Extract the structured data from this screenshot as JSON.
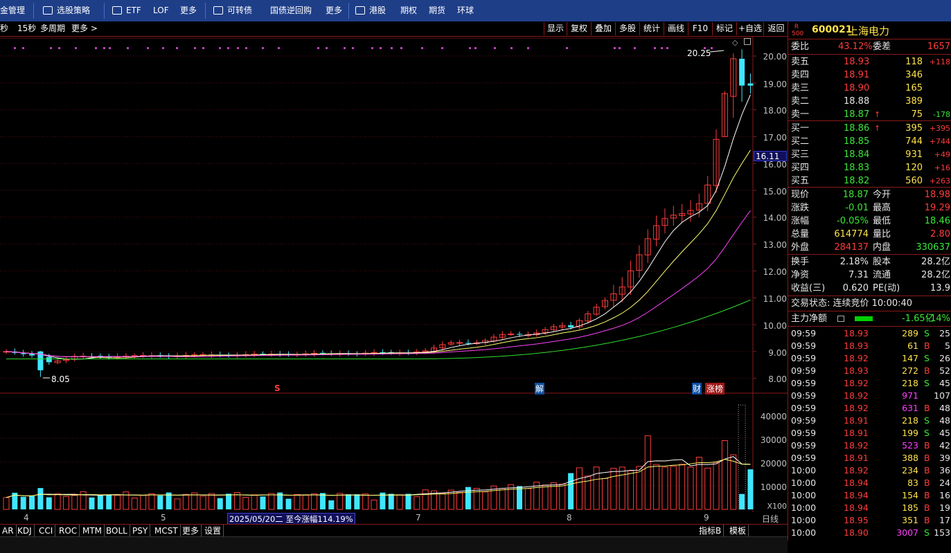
{
  "topbar": {
    "items": [
      "金管理",
      "选股策略",
      "ETF",
      "LOF",
      "更多",
      "可转债",
      "国债逆回购",
      "更多",
      "港股",
      "期权",
      "期货",
      "环球"
    ]
  },
  "toolbar": {
    "period_labels": [
      "秒",
      "15秒",
      "多周期",
      "更多 >"
    ],
    "buttons": [
      "显示",
      "复权",
      "叠加",
      "多股",
      "统计",
      "画线",
      "F10",
      "标记",
      "+自选",
      "返回"
    ]
  },
  "chart": {
    "price_labels": [
      "20.00",
      "19.00",
      "18.00",
      "17.00",
      "16.00",
      "15.00",
      "14.00",
      "13.00",
      "12.00",
      "11.00",
      "10.00",
      "9.00",
      "8.00"
    ],
    "volume_labels": [
      "40000",
      "30000",
      "20000",
      "10000",
      "X100"
    ],
    "current_price": "16.11",
    "high_marker": "20.25",
    "low_marker": "8.05",
    "markers": {
      "s": "S",
      "jie": "解",
      "cai": "财",
      "zhangbang": "涨榜"
    },
    "x_labels": [
      "4",
      "5",
      "7",
      "8",
      "9",
      "日线"
    ],
    "range_note": "2025/05/20二 至今涨幅114.19%",
    "colors": {
      "up": "#ff3c3c",
      "down": "#3fe6ff",
      "ma5": "#ffffff",
      "ma10": "#ffff70",
      "ma20": "#ff40ff",
      "ma60": "#30e030"
    }
  },
  "chart_data": {
    "type": "candlestick",
    "ylim": [
      7.8,
      20.4
    ],
    "volume_ylim": [
      0,
      45000
    ],
    "volume_unit": "X100",
    "low_value": 8.05,
    "high_value": 20.25,
    "x_ticks": [
      "4",
      "5",
      "7",
      "8",
      "9"
    ],
    "candles": []
  },
  "bottom_tabs": [
    "AR",
    "KDJ",
    "CCI",
    "ROC",
    "MTM",
    "BOLL",
    "PSY",
    "MCST",
    "更多",
    "设置"
  ],
  "bottom_right": [
    "指标B",
    "模板"
  ],
  "quote": {
    "code": "600021",
    "name": "上海电力",
    "badge_top": "R",
    "badge_bottom": "500",
    "weibi_label": "委比",
    "weibi": "43.12%",
    "weicha_label": "委差",
    "weicha": "1657",
    "asks": [
      {
        "label": "卖五",
        "price": "18.93",
        "vol": "118",
        "chg": "+118"
      },
      {
        "label": "卖四",
        "price": "18.91",
        "vol": "346",
        "chg": ""
      },
      {
        "label": "卖三",
        "price": "18.90",
        "vol": "165",
        "chg": ""
      },
      {
        "label": "卖二",
        "price": "18.88",
        "vol": "389",
        "chg": ""
      },
      {
        "label": "卖一",
        "price": "18.87",
        "vol": "75",
        "chg": "-178"
      }
    ],
    "bids": [
      {
        "label": "买一",
        "price": "18.86",
        "vol": "395",
        "chg": "+395"
      },
      {
        "label": "买二",
        "price": "18.85",
        "vol": "744",
        "chg": "+744"
      },
      {
        "label": "买三",
        "price": "18.84",
        "vol": "931",
        "chg": "+49"
      },
      {
        "label": "买四",
        "price": "18.83",
        "vol": "120",
        "chg": "+16"
      },
      {
        "label": "买五",
        "price": "18.82",
        "vol": "560",
        "chg": "+263"
      }
    ],
    "stats": [
      {
        "l1": "现价",
        "v1": "18.87",
        "l2": "今开",
        "v2": "18.98"
      },
      {
        "l1": "涨跌",
        "v1": "-0.01",
        "l2": "最高",
        "v2": "19.29"
      },
      {
        "l1": "涨幅",
        "v1": "-0.05%",
        "l2": "最低",
        "v2": "18.46"
      },
      {
        "l1": "总量",
        "v1": "614774",
        "l2": "量比",
        "v2": "2.80"
      },
      {
        "l1": "外盘",
        "v1": "284137",
        "l2": "内盘",
        "v2": "330637"
      }
    ],
    "stats2": [
      {
        "l1": "换手",
        "v1": "2.18%",
        "l2": "股本",
        "v2": "28.2亿"
      },
      {
        "l1": "净资",
        "v1": "7.31",
        "l2": "流通",
        "v2": "28.2亿"
      },
      {
        "l1": "收益(三)",
        "v1": "0.620",
        "l2": "PE(动)",
        "v2": "13.9"
      }
    ],
    "trade_status": "交易状态: 连续竞价 10:00:40",
    "main_flow_label": "主力净额",
    "main_flow_value": "-1.65亿",
    "main_flow_pct": "-14%",
    "ticks": [
      {
        "t": "09:59",
        "p": "18.93",
        "v": "289",
        "s": "S",
        "n": "25"
      },
      {
        "t": "09:59",
        "p": "18.93",
        "v": "61",
        "s": "B",
        "n": "5"
      },
      {
        "t": "09:59",
        "p": "18.92",
        "v": "147",
        "s": "S",
        "n": "26"
      },
      {
        "t": "09:59",
        "p": "18.93",
        "v": "272",
        "s": "B",
        "n": "52"
      },
      {
        "t": "09:59",
        "p": "18.92",
        "v": "218",
        "s": "S",
        "n": "45"
      },
      {
        "t": "09:59",
        "p": "18.92",
        "v": "971",
        "s": "",
        "n": "107"
      },
      {
        "t": "09:59",
        "p": "18.92",
        "v": "631",
        "s": "B",
        "n": "48"
      },
      {
        "t": "09:59",
        "p": "18.91",
        "v": "218",
        "s": "S",
        "n": "48"
      },
      {
        "t": "09:59",
        "p": "18.91",
        "v": "199",
        "s": "S",
        "n": "45"
      },
      {
        "t": "09:59",
        "p": "18.92",
        "v": "523",
        "s": "B",
        "n": "42"
      },
      {
        "t": "09:59",
        "p": "18.91",
        "v": "388",
        "s": "B",
        "n": "39"
      },
      {
        "t": "10:00",
        "p": "18.92",
        "v": "234",
        "s": "B",
        "n": "36"
      },
      {
        "t": "10:00",
        "p": "18.94",
        "v": "83",
        "s": "B",
        "n": "24"
      },
      {
        "t": "10:00",
        "p": "18.94",
        "v": "154",
        "s": "B",
        "n": "16"
      },
      {
        "t": "10:00",
        "p": "18.94",
        "v": "185",
        "s": "B",
        "n": "19"
      },
      {
        "t": "10:00",
        "p": "18.95",
        "v": "351",
        "s": "B",
        "n": "17"
      },
      {
        "t": "10:00",
        "p": "18.90",
        "v": "3007",
        "s": "S",
        "n": "153"
      }
    ]
  }
}
